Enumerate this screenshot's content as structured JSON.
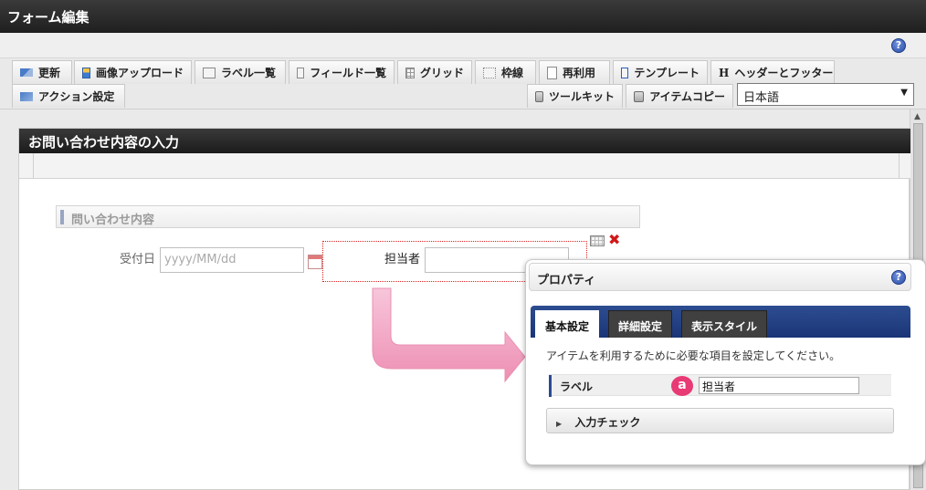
{
  "window": {
    "title": "フォーム編集"
  },
  "toolbar": {
    "update": "更新",
    "image_upload": "画像アップロード",
    "label_list": "ラベル一覧",
    "field_list": "フィールド一覧",
    "grid": "グリッド",
    "frame": "枠線",
    "reuse": "再利用",
    "template": "テンプレート",
    "header_footer": "ヘッダーとフッター",
    "action_settings": "アクション設定",
    "toolkit": "ツールキット",
    "item_copy": "アイテムコピー",
    "language": "日本語"
  },
  "form": {
    "title": "お問い合わせ内容の入力",
    "section": "問い合わせ内容",
    "reception_label": "受付日",
    "reception_placeholder": "yyyy/MM/dd",
    "person_label": "担当者"
  },
  "properties": {
    "title": "プロパティ",
    "tabs": [
      "基本設定",
      "詳細設定",
      "表示スタイル"
    ],
    "active_tab": "基本設定",
    "description": "アイテムを利用するために必要な項目を設定してください。",
    "label_field_name": "ラベル",
    "label_value": "担当者",
    "badge": "a",
    "input_check": "入力チェック"
  },
  "icons": {
    "help": "help-icon",
    "close": "close-icon"
  }
}
